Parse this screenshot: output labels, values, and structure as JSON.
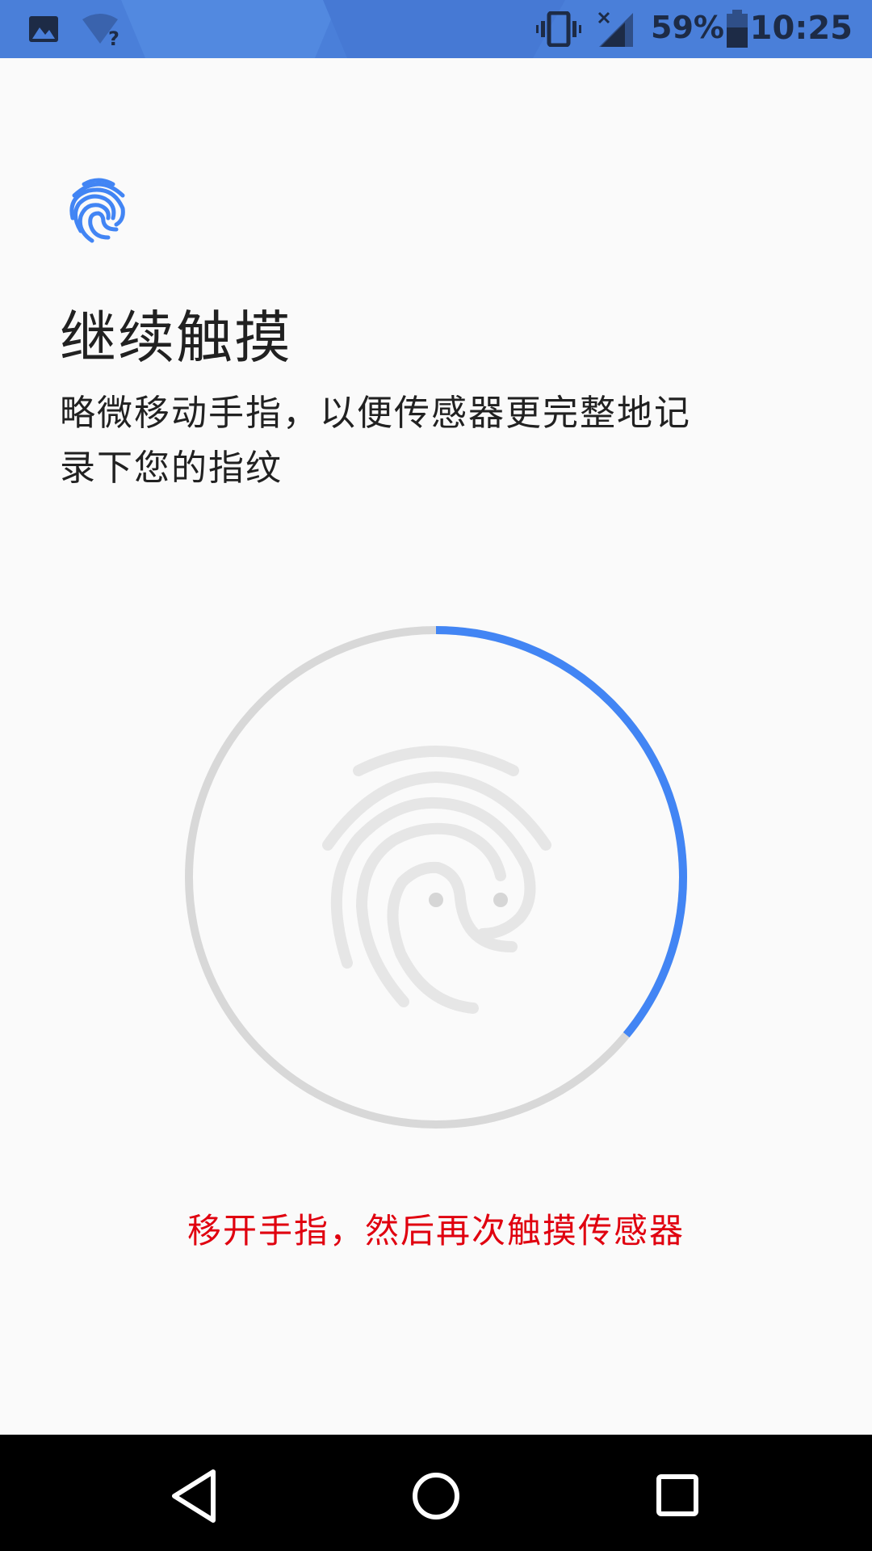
{
  "status_bar": {
    "battery_percent": "59%",
    "time": "10:25",
    "icons": [
      "gallery-icon",
      "wifi-unknown-icon",
      "vibrate-icon",
      "no-signal-icon",
      "battery-icon"
    ]
  },
  "enroll": {
    "title": "继续触摸",
    "description": "略微移动手指，以便传感器更完整地记录下您的指纹",
    "error": "移开手指，然后再次触摸传感器",
    "progress_fraction": 0.36,
    "accent_color": "#4285f4",
    "track_color": "#d8d8d8",
    "error_color": "#e0000f"
  },
  "nav_bar": {
    "buttons": [
      "back",
      "home",
      "recents"
    ]
  }
}
